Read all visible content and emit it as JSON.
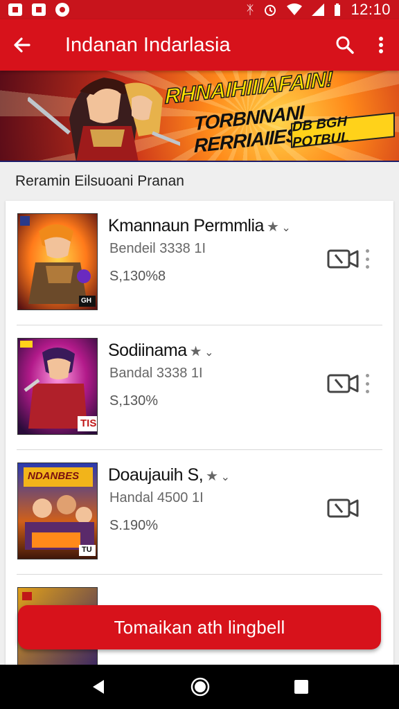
{
  "status_bar": {
    "time": "12:10"
  },
  "app_bar": {
    "title": "Indanan Indarlasia",
    "back_icon": "arrow-left-icon",
    "search_icon": "search-icon",
    "more_icon": "more-vertical-icon"
  },
  "banner": {
    "headline": "RHNAIHIIIAFAIN!",
    "subheadline": "TORBNNANI RERRIAIIES",
    "pill": "DB BGH POTBUL"
  },
  "section": {
    "label": "Reramin Eilsuoani Pranan"
  },
  "items": [
    {
      "title": "Kmannaun Permmlia",
      "subtitle": "Bendeil 3338 1I",
      "price": "S,130%8",
      "thumb_label": "GH"
    },
    {
      "title": "Sodiinama",
      "subtitle": "Bandal 3338 1I",
      "price": "S,130%",
      "thumb_label": "TIS"
    },
    {
      "title": "Doaujauih S,",
      "subtitle": "Handal 4500 1I",
      "price": "S.190%",
      "thumb_label": "NDANBES",
      "thumb_label2": "TU"
    }
  ],
  "cta": {
    "label": "Tomaikan ath lingbell"
  },
  "colors": {
    "primary": "#d7121b",
    "status": "#c8141c"
  }
}
